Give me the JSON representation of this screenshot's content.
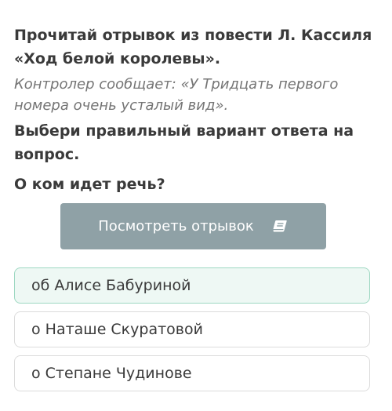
{
  "task": {
    "heading": "Прочитай отрывок из повести Л. Кассиля «Ход белой королевы».",
    "quote": "Контролер сообщает: «У Тридцать первого номера очень усталый вид».",
    "question": "Выбери правильный вариант ответа на вопрос.",
    "ask": "О ком идет речь?"
  },
  "view_button": {
    "label": "Посмотреть отрывок",
    "icon": "book-icon"
  },
  "options": [
    {
      "label": "об Алисе Бабуриной",
      "selected": true
    },
    {
      "label": "о Наташе Скуратовой",
      "selected": false
    },
    {
      "label": "о Степане Чудинове",
      "selected": false
    }
  ],
  "colors": {
    "button_bg": "#8fa1a6",
    "selected_bg": "#eef8f4",
    "selected_border": "#9ed8c2",
    "option_border": "#dcdcdc"
  }
}
